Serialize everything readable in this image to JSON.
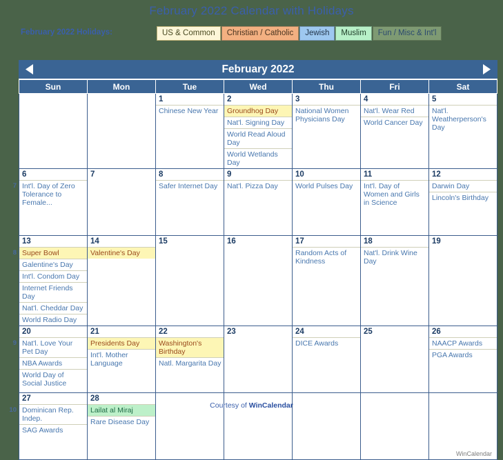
{
  "header": {
    "doc_title": "February 2022 Calendar with Holidays",
    "legend_label": "February 2022 Holidays:",
    "legend": [
      {
        "label": "US & Common",
        "key": "us",
        "color": "#fdf6d8"
      },
      {
        "label": "Christian / Catholic",
        "key": "christian",
        "color": "#f3b081"
      },
      {
        "label": "Jewish",
        "key": "jewish",
        "color": "#9ec8f0"
      },
      {
        "label": "Muslim",
        "key": "muslim",
        "color": "#b8f0c8"
      },
      {
        "label": "Fun / Misc & Int'l",
        "key": "fun",
        "color": "#7e9a73"
      }
    ]
  },
  "calendar": {
    "month_title": "February 2022",
    "prev_label": "◀",
    "next_label": "▶",
    "weekday_headers": [
      "Sun",
      "Mon",
      "Tue",
      "Wed",
      "Thu",
      "Fri",
      "Sat"
    ],
    "week_numbers": [
      "",
      "7",
      "8",
      "9",
      "10"
    ],
    "weeks": [
      [
        {
          "blank": true
        },
        {
          "blank": true
        },
        {
          "day": "1",
          "events": [
            {
              "text": "Chinese New Year",
              "type": "plain"
            }
          ]
        },
        {
          "day": "2",
          "events": [
            {
              "text": "Groundhog Day",
              "type": "us"
            },
            {
              "text": "Nat'l. Signing Day",
              "type": "plain"
            },
            {
              "text": "World Read Aloud Day",
              "type": "plain"
            },
            {
              "text": "World Wetlands Day",
              "type": "plain"
            }
          ]
        },
        {
          "day": "3",
          "events": [
            {
              "text": "National Women Physicians Day",
              "type": "plain"
            }
          ]
        },
        {
          "day": "4",
          "events": [
            {
              "text": "Nat'l. Wear Red",
              "type": "plain"
            },
            {
              "text": "World Cancer Day",
              "type": "plain"
            }
          ]
        },
        {
          "day": "5",
          "weekend": true,
          "events": [
            {
              "text": "Nat'l. Weatherperson's Day",
              "type": "plain"
            }
          ]
        }
      ],
      [
        {
          "day": "6",
          "weekend": true,
          "events": [
            {
              "text": "Int'l. Day of Zero Tolerance to Female...",
              "type": "plain"
            }
          ]
        },
        {
          "day": "7",
          "events": []
        },
        {
          "day": "8",
          "events": [
            {
              "text": "Safer Internet Day",
              "type": "plain"
            }
          ]
        },
        {
          "day": "9",
          "events": [
            {
              "text": "Nat'l. Pizza Day",
              "type": "plain"
            }
          ]
        },
        {
          "day": "10",
          "events": [
            {
              "text": "World Pulses Day",
              "type": "plain"
            }
          ]
        },
        {
          "day": "11",
          "events": [
            {
              "text": "Int'l. Day of Women and Girls in Science",
              "type": "plain"
            }
          ]
        },
        {
          "day": "12",
          "weekend": true,
          "events": [
            {
              "text": "Darwin Day",
              "type": "plain"
            },
            {
              "text": "Lincoln's Birthday",
              "type": "plain"
            }
          ]
        }
      ],
      [
        {
          "day": "13",
          "weekend": true,
          "events": [
            {
              "text": "Super Bowl",
              "type": "us"
            },
            {
              "text": "Galentine's Day",
              "type": "plain"
            },
            {
              "text": "Int'l. Condom Day",
              "type": "plain"
            },
            {
              "text": "Internet Friends Day",
              "type": "plain"
            },
            {
              "text": "Nat'l. Cheddar Day",
              "type": "plain"
            },
            {
              "text": "World Radio Day",
              "type": "plain"
            }
          ]
        },
        {
          "day": "14",
          "events": [
            {
              "text": "Valentine's Day",
              "type": "us"
            }
          ]
        },
        {
          "day": "15",
          "events": []
        },
        {
          "day": "16",
          "events": []
        },
        {
          "day": "17",
          "events": [
            {
              "text": "Random Acts of Kindness",
              "type": "plain"
            }
          ]
        },
        {
          "day": "18",
          "events": [
            {
              "text": "Nat'l. Drink Wine Day",
              "type": "plain"
            }
          ]
        },
        {
          "day": "19",
          "weekend": true,
          "events": []
        }
      ],
      [
        {
          "day": "20",
          "weekend": true,
          "events": [
            {
              "text": "Nat'l. Love Your Pet Day",
              "type": "plain"
            },
            {
              "text": "NBA Awards",
              "type": "plain"
            },
            {
              "text": "World Day of Social Justice",
              "type": "plain"
            }
          ]
        },
        {
          "day": "21",
          "events": [
            {
              "text": "Presidents Day",
              "type": "us"
            },
            {
              "text": "Int'l. Mother Language",
              "type": "plain"
            }
          ]
        },
        {
          "day": "22",
          "events": [
            {
              "text": "Washington's Birthday",
              "type": "us"
            },
            {
              "text": "Natl. Margarita Day",
              "type": "plain"
            }
          ]
        },
        {
          "day": "23",
          "events": []
        },
        {
          "day": "24",
          "events": [
            {
              "text": "DICE Awards",
              "type": "plain"
            }
          ]
        },
        {
          "day": "25",
          "events": []
        },
        {
          "day": "26",
          "weekend": true,
          "events": [
            {
              "text": "NAACP Awards",
              "type": "plain"
            },
            {
              "text": "PGA Awards",
              "type": "plain"
            }
          ]
        }
      ],
      [
        {
          "day": "27",
          "weekend": true,
          "events": [
            {
              "text": "Dominican Rep. Indep.",
              "type": "plain"
            },
            {
              "text": "SAG Awards",
              "type": "plain"
            }
          ]
        },
        {
          "day": "28",
          "events": [
            {
              "text": "Lailat al Miraj",
              "type": "muslim"
            },
            {
              "text": "Rare Disease Day",
              "type": "plain"
            }
          ]
        },
        {
          "blank": true
        },
        {
          "blank": true
        },
        {
          "blank": true
        },
        {
          "blank": true
        },
        {
          "blank": true
        }
      ]
    ],
    "watermark": "WinCalendar"
  },
  "footer": {
    "courtesy_prefix": "Courtesy of ",
    "courtesy_brand": "WinCalendar"
  }
}
